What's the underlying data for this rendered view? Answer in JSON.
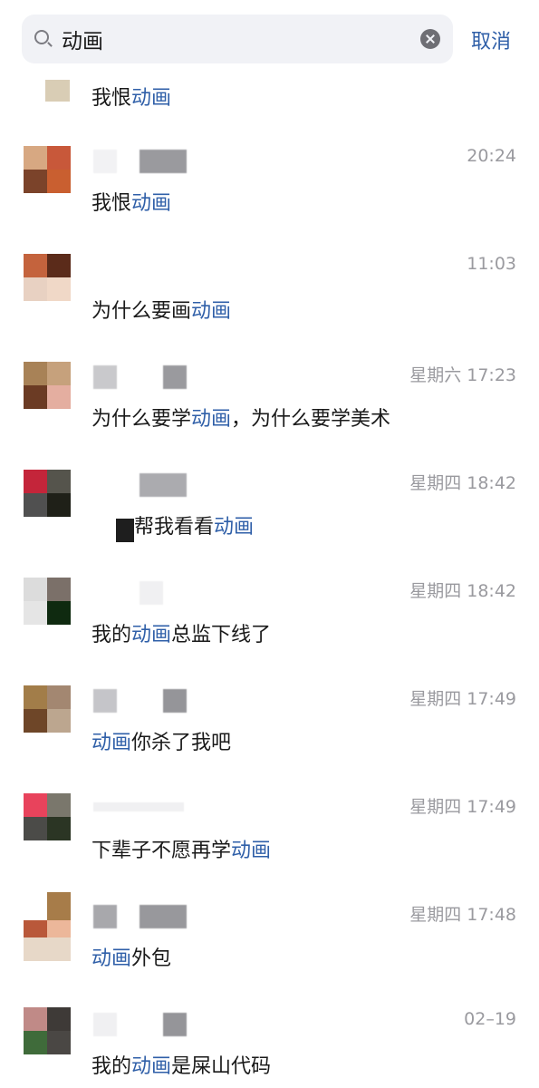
{
  "search": {
    "query": "动画",
    "cancel_label": "取消"
  },
  "results": [
    {
      "time": "",
      "pre": "我恨",
      "kw": "动画",
      "post": ""
    },
    {
      "time": "20:24",
      "pre": "我恨",
      "kw": "动画",
      "post": ""
    },
    {
      "time": "11:03",
      "pre": "为什么要画",
      "kw": "动画",
      "post": ""
    },
    {
      "time": "星期六 17:23",
      "pre": "为什么要学",
      "kw": "动画",
      "post": "，为什么要学美术"
    },
    {
      "time": "星期四 18:42",
      "pre": "帮我看看",
      "kw": "动画",
      "post": ""
    },
    {
      "time": "星期四 18:42",
      "pre": "我的",
      "kw": "动画",
      "post": "总监下线了"
    },
    {
      "time": "星期四 17:49",
      "pre": "",
      "kw": "动画",
      "post": "你杀了我吧"
    },
    {
      "time": "星期四 17:49",
      "pre": "下辈子不愿再学",
      "kw": "动画",
      "post": ""
    },
    {
      "time": "星期四 17:48",
      "pre": "",
      "kw": "动画",
      "post": "外包"
    },
    {
      "time": "02–19",
      "pre": "我的",
      "kw": "动画",
      "post": "是屎山代码"
    }
  ],
  "colors": {
    "highlight": "#2f5fa8",
    "timestamp": "#9a9a9f"
  }
}
